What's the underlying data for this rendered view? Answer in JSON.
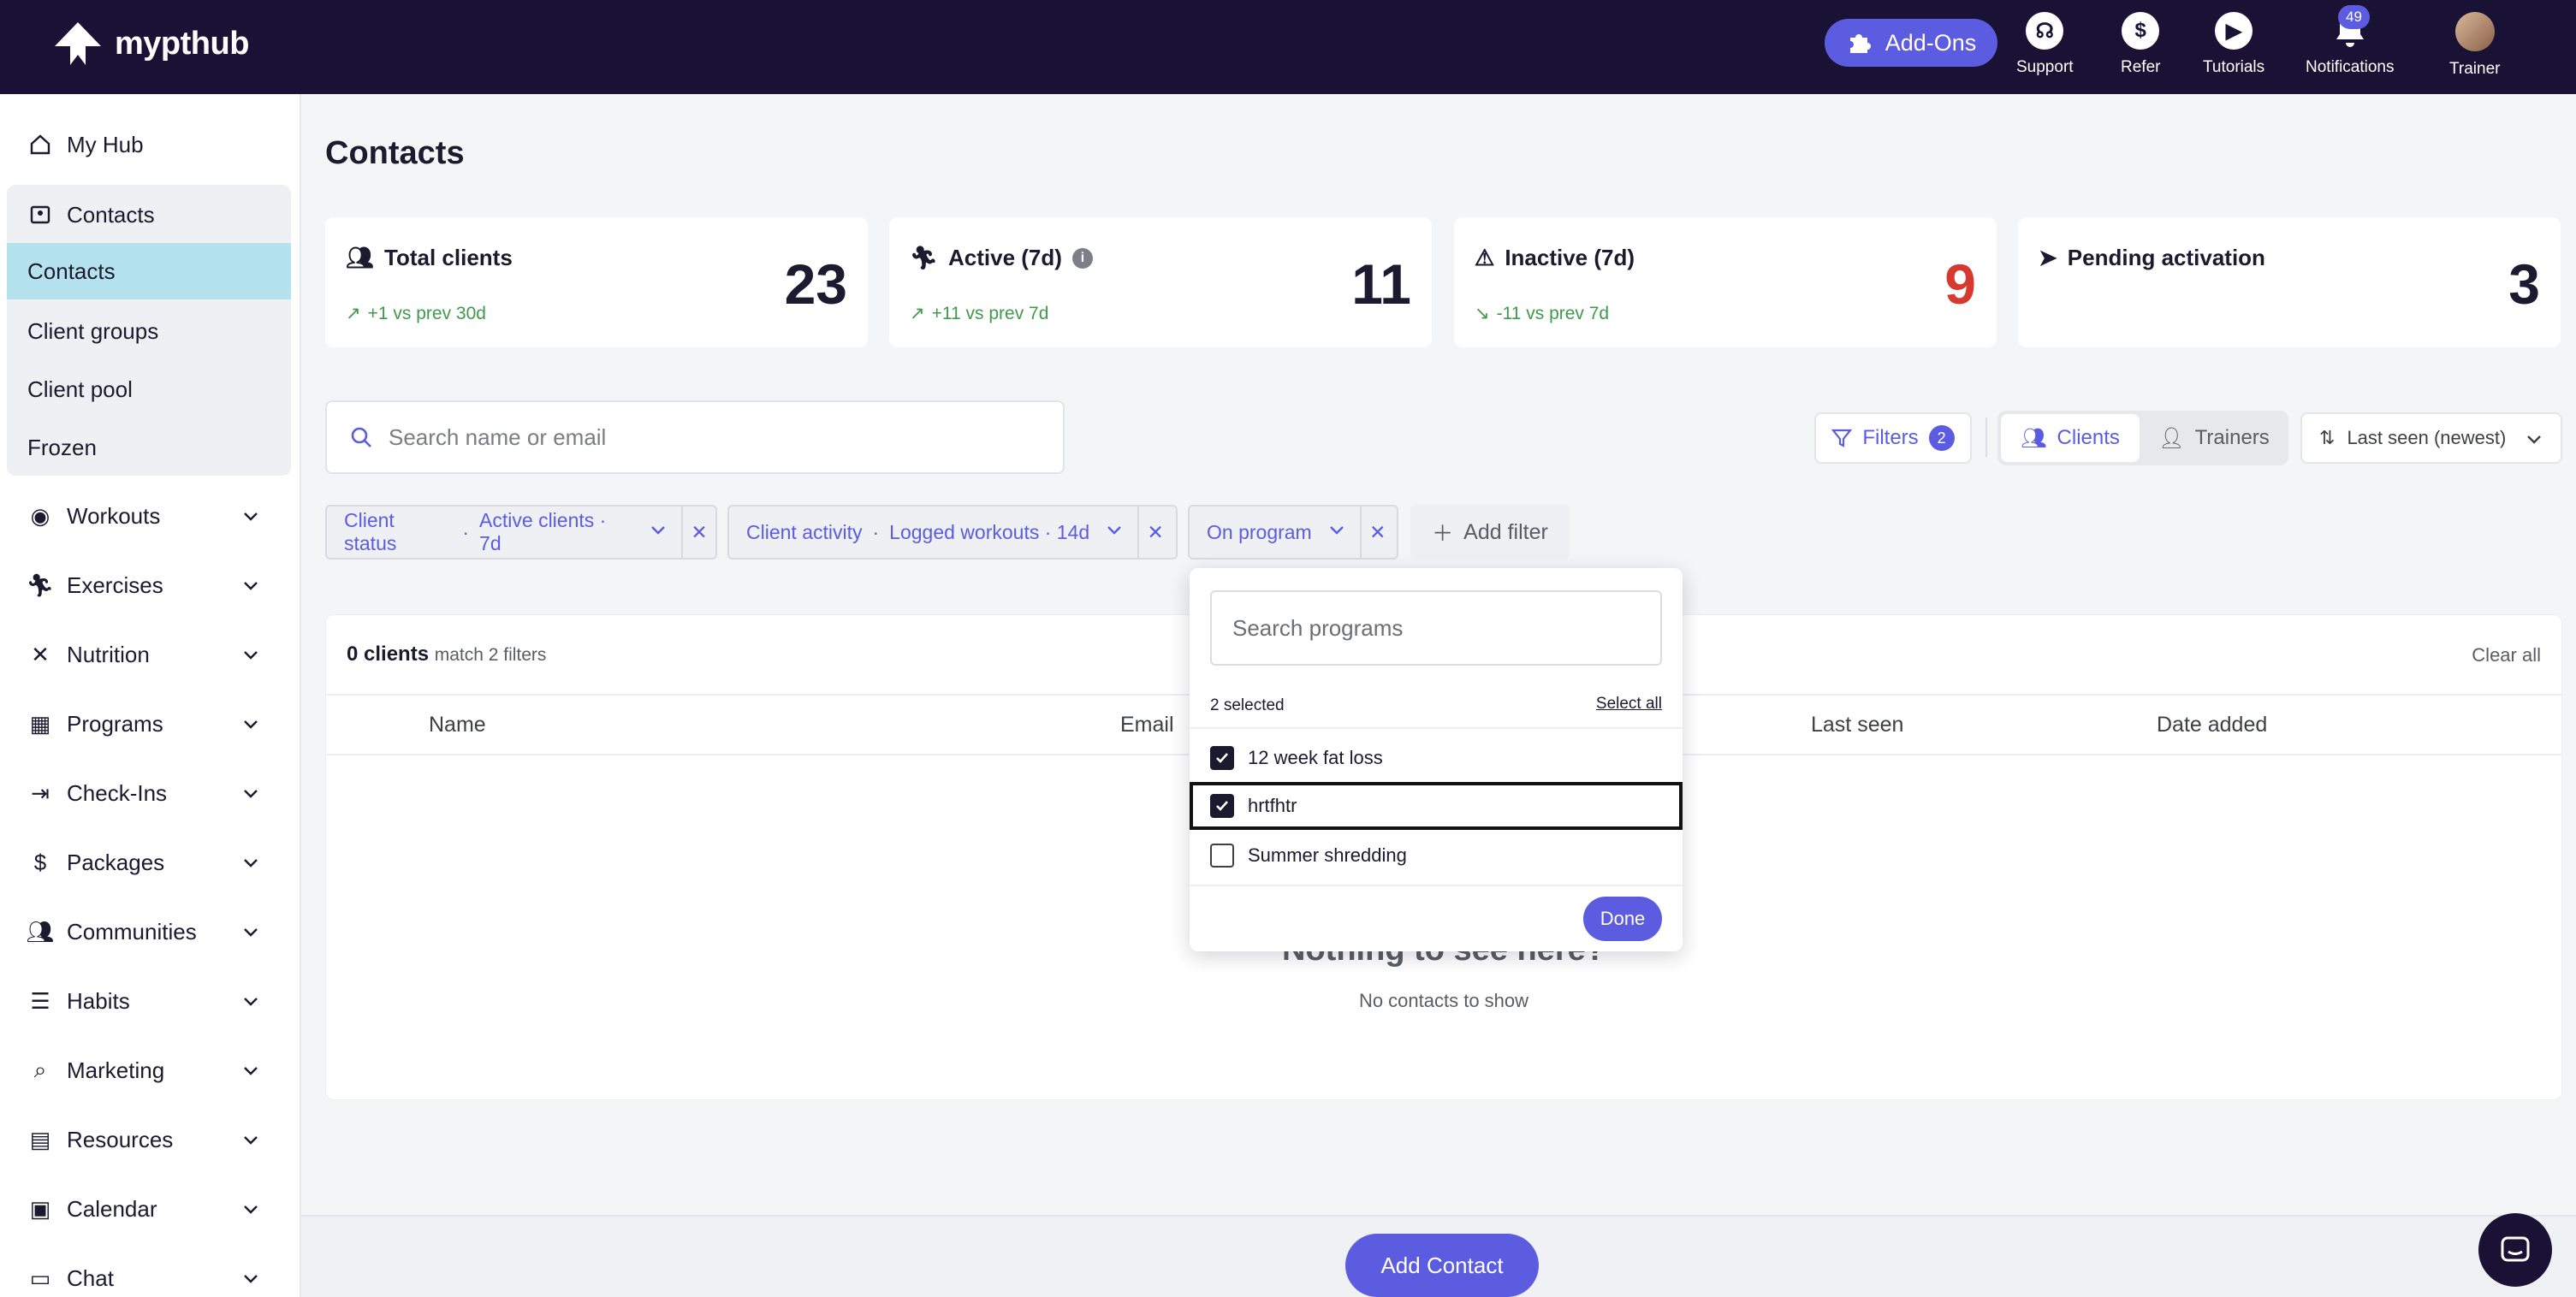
{
  "brand": {
    "name": "mypthub"
  },
  "topnav": {
    "addons": "Add-Ons",
    "support": "Support",
    "refer": "Refer",
    "tutorials": "Tutorials",
    "notifications": "Notifications",
    "notifications_count": "49",
    "trainer": "Trainer"
  },
  "sidebar": {
    "my_hub": "My Hub",
    "contacts": "Contacts",
    "sub": [
      "Contacts",
      "Client groups",
      "Client pool",
      "Frozen"
    ],
    "items": [
      "Workouts",
      "Exercises",
      "Nutrition",
      "Programs",
      "Check-Ins",
      "Packages",
      "Communities",
      "Habits",
      "Marketing",
      "Resources",
      "Calendar",
      "Chat"
    ]
  },
  "page": {
    "title": "Contacts"
  },
  "stats": [
    {
      "label": "Total clients",
      "trend": "+1 vs prev 30d",
      "value": "23"
    },
    {
      "label": "Active (7d)",
      "trend": "+11 vs prev 7d",
      "value": "11"
    },
    {
      "label": "Inactive (7d)",
      "trend": "-11 vs prev 7d",
      "value": "9"
    },
    {
      "label": "Pending activation",
      "trend": "",
      "value": "3"
    }
  ],
  "search": {
    "placeholder": "Search name or email"
  },
  "toolbar": {
    "filters": "Filters",
    "filters_count": "2",
    "clients": "Clients",
    "trainers": "Trainers",
    "sort": "Last seen (newest)"
  },
  "chips": [
    {
      "label": "Client status",
      "value": "Active clients · 7d"
    },
    {
      "label": "Client activity",
      "value": "Logged workouts · 14d"
    },
    {
      "label": "On program",
      "value": ""
    }
  ],
  "add_filter": "Add filter",
  "table": {
    "count": "0 clients",
    "count_sub": "match 2 filters",
    "clear_all": "Clear all",
    "columns": [
      "Name",
      "Email",
      "Last seen",
      "Date added"
    ],
    "empty_title": "Nothing to see here?",
    "empty_sub": "No contacts to show"
  },
  "dropdown": {
    "placeholder": "Search programs",
    "selected": "2 selected",
    "select_all": "Select all",
    "options": [
      {
        "label": "12 week fat loss",
        "checked": true
      },
      {
        "label": "hrtfhtr",
        "checked": true
      },
      {
        "label": "Summer shredding",
        "checked": false
      }
    ],
    "done": "Done"
  },
  "add_contact": "Add Contact",
  "colors": {
    "accent": "#5c5ce0",
    "topbar": "#1a1235",
    "positive": "#3f9a4c",
    "negative": "#d63a2f",
    "selected_nav": "#b5e3ed"
  }
}
